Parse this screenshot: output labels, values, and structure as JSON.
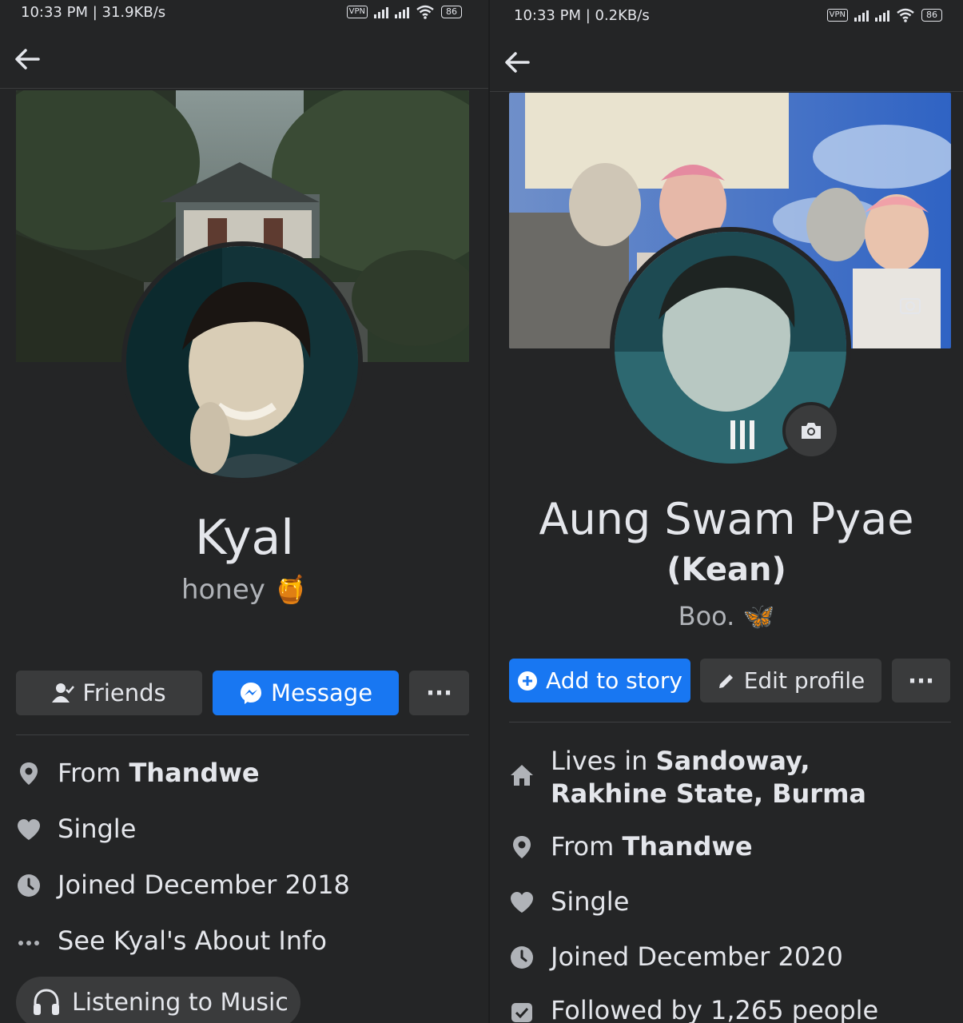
{
  "left": {
    "status": {
      "time": "10:33 PM | 31.9KB/s",
      "vpn": "VPN",
      "battery": "86"
    },
    "profile": {
      "name": "Kyal",
      "bio": "honey 🍯"
    },
    "buttons": {
      "friends": "Friends",
      "message": "Message",
      "more": "···"
    },
    "info": {
      "from_prefix": "From ",
      "from_value": "Thandwe",
      "relationship": "Single",
      "joined": "Joined December 2018",
      "about": "See Kyal's About Info"
    },
    "activity": "Listening to Music"
  },
  "right": {
    "status": {
      "time": "10:33 PM | 0.2KB/s",
      "vpn": "VPN",
      "battery": "86"
    },
    "profile": {
      "name": "Aung Swam Pyae",
      "nickname": "(Kean)",
      "bio": "Boo. 🦋"
    },
    "buttons": {
      "add_story": "Add to story",
      "edit_profile": "Edit profile",
      "more": "···"
    },
    "info": {
      "lives_prefix": "Lives in ",
      "lives_value": "Sandoway, Rakhine State, Burma",
      "from_prefix": "From ",
      "from_value": "Thandwe",
      "relationship": "Single",
      "joined": "Joined December 2020",
      "followed": "Followed by 1,265 people"
    }
  },
  "colors": {
    "accent": "#1877f2",
    "background": "#242526",
    "surface": "#3a3b3c",
    "text": "#e4e6eb",
    "muted": "#b0b3b8"
  },
  "icons": [
    "back-arrow-icon",
    "location-pin-icon",
    "heart-icon",
    "clock-icon",
    "more-dots-icon",
    "headphones-icon",
    "home-icon",
    "rss-icon",
    "camera-icon",
    "plus-circle-icon",
    "pencil-icon",
    "messenger-icon",
    "friend-check-icon"
  ]
}
